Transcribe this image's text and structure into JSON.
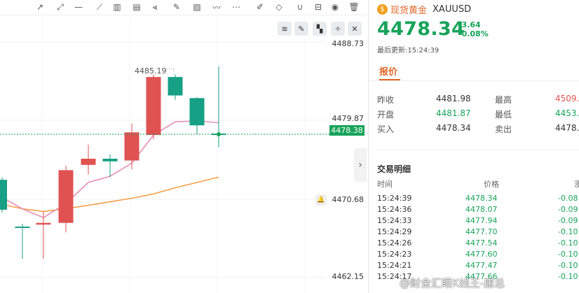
{
  "toolbar": {
    "tools": [
      {
        "name": "trend-line-icon",
        "glyph": "↗"
      },
      {
        "name": "ray-icon",
        "glyph": "⤢"
      },
      {
        "name": "horizontal-line-icon",
        "glyph": "—"
      },
      {
        "name": "polyline-icon",
        "glyph": "⟋"
      },
      {
        "name": "channel-icon",
        "glyph": "▥"
      },
      {
        "name": "fib-icon",
        "glyph": "▤"
      },
      {
        "name": "fan-icon",
        "glyph": "⫷"
      },
      {
        "name": "brush-icon",
        "glyph": "✎"
      },
      {
        "name": "image-icon",
        "glyph": "▨"
      },
      {
        "name": "wave-icon",
        "glyph": "〰"
      },
      {
        "name": "more-icon",
        "glyph": "⋯"
      },
      {
        "name": "edit-icon",
        "glyph": "✐"
      },
      {
        "name": "eraser-icon",
        "glyph": "◇"
      },
      {
        "name": "magnet-icon",
        "glyph": "∪"
      },
      {
        "name": "lock-icon",
        "glyph": "⊟"
      },
      {
        "name": "eye-icon",
        "glyph": "◉"
      },
      {
        "name": "trash-icon",
        "glyph": "🗑"
      }
    ]
  },
  "chart": {
    "buttons": [
      "≋",
      "✎",
      "▚",
      "✧",
      "✕"
    ],
    "price_axis": [
      {
        "value": "4488.73",
        "color": "#e55353"
      },
      {
        "value": "4479.87",
        "color": "#17a35a"
      },
      {
        "value": "4470.68",
        "color": "#555555"
      },
      {
        "value": "4462.15",
        "color": "#17a35a"
      }
    ],
    "current_price": "4478.38",
    "high_marker": "4485.19",
    "collapse_glyph": "›",
    "bell_glyph": "🔔"
  },
  "chart_data": {
    "type": "candlestick",
    "title": "",
    "ylim": [
      4462.15,
      4488.73
    ],
    "candles": [
      {
        "open": 4473.2,
        "close": 4469.8,
        "high": 4473.5,
        "low": 4469.5,
        "dir": "down-green"
      },
      {
        "open": 4467.8,
        "close": 4467.8,
        "high": 4468.2,
        "low": 4464.2,
        "dir": "flat"
      },
      {
        "open": 4468.3,
        "close": 4468.1,
        "high": 4469.6,
        "low": 4464.2,
        "dir": "up-red"
      },
      {
        "open": 4468.3,
        "close": 4474.3,
        "high": 4474.8,
        "low": 4467.2,
        "dir": "up-red"
      },
      {
        "open": 4474.9,
        "close": 4475.6,
        "high": 4477.2,
        "low": 4473.8,
        "dir": "up-red"
      },
      {
        "open": 4475.6,
        "close": 4475.3,
        "high": 4476.1,
        "low": 4473.5,
        "dir": "down-green"
      },
      {
        "open": 4475.4,
        "close": 4478.6,
        "high": 4479.6,
        "low": 4474.4,
        "dir": "up-red"
      },
      {
        "open": 4478.3,
        "close": 4484.9,
        "high": 4485.19,
        "low": 4477.8,
        "dir": "up-red"
      },
      {
        "open": 4484.9,
        "close": 4482.8,
        "high": 4485.19,
        "low": 4482.3,
        "dir": "down-green"
      },
      {
        "open": 4482.5,
        "close": 4479.4,
        "high": 4482.6,
        "low": 4478.4,
        "dir": "down-green"
      },
      {
        "open": 4478.38,
        "close": 4478.38,
        "high": 4486.1,
        "low": 4476.9,
        "dir": "down-green"
      }
    ],
    "ma_fast": [
      4471.2,
      4469.9,
      4468.9,
      4470.5,
      4472.9,
      4473.6,
      4475.1,
      4478.3,
      4479.8,
      4479.9,
      4479.7
    ],
    "ma_slow": [
      4470.4,
      4469.9,
      4469.6,
      4469.9,
      4470.3,
      4470.7,
      4471.1,
      4471.6,
      4472.3,
      4472.9,
      4473.5
    ]
  },
  "quote": {
    "symbol_name": "现货黄金",
    "symbol_code": "XAUUSD",
    "coin_glyph": "$",
    "price": "4478.34",
    "change": "-3.64",
    "change_pct": "-0.08%",
    "updated_label": "最后更新:",
    "updated_time": "15:24:39",
    "tab_label": "报价",
    "rows": [
      {
        "l1": "昨收",
        "v1": "4481.98",
        "l2": "最高",
        "v2": "4509.",
        "v2_color": "#e55353"
      },
      {
        "l1": "开盘",
        "v1": "4481.87",
        "v1_color": "#17a35a",
        "l2": "最低",
        "v2": "4453.",
        "v2_color": "#17a35a"
      },
      {
        "l1": "买入",
        "v1": "4478.34",
        "l2": "卖出",
        "v2": "4478."
      }
    ]
  },
  "deals": {
    "title": "交易明细",
    "headers": {
      "time": "时间",
      "price": "价格",
      "change": "涨"
    },
    "rows": [
      {
        "time": "15:24:39",
        "price": "4478.34",
        "change": "-0.08"
      },
      {
        "time": "15:24:36",
        "price": "4478.07",
        "change": "-0.09"
      },
      {
        "time": "15:24:33",
        "price": "4477.94",
        "change": "-0.09"
      },
      {
        "time": "15:24:29",
        "price": "4477.70",
        "change": "-0.10"
      },
      {
        "time": "15:24:26",
        "price": "4477.54",
        "change": "-0.10"
      },
      {
        "time": "15:24:23",
        "price": "4477.60",
        "change": "-0.10"
      },
      {
        "time": "15:24:21",
        "price": "4477.47",
        "change": "-0.10"
      },
      {
        "time": "15:24:17",
        "price": "4477.66",
        "change": "-0.10"
      }
    ]
  },
  "watermark": "@财金汇眼K线王-唐总"
}
